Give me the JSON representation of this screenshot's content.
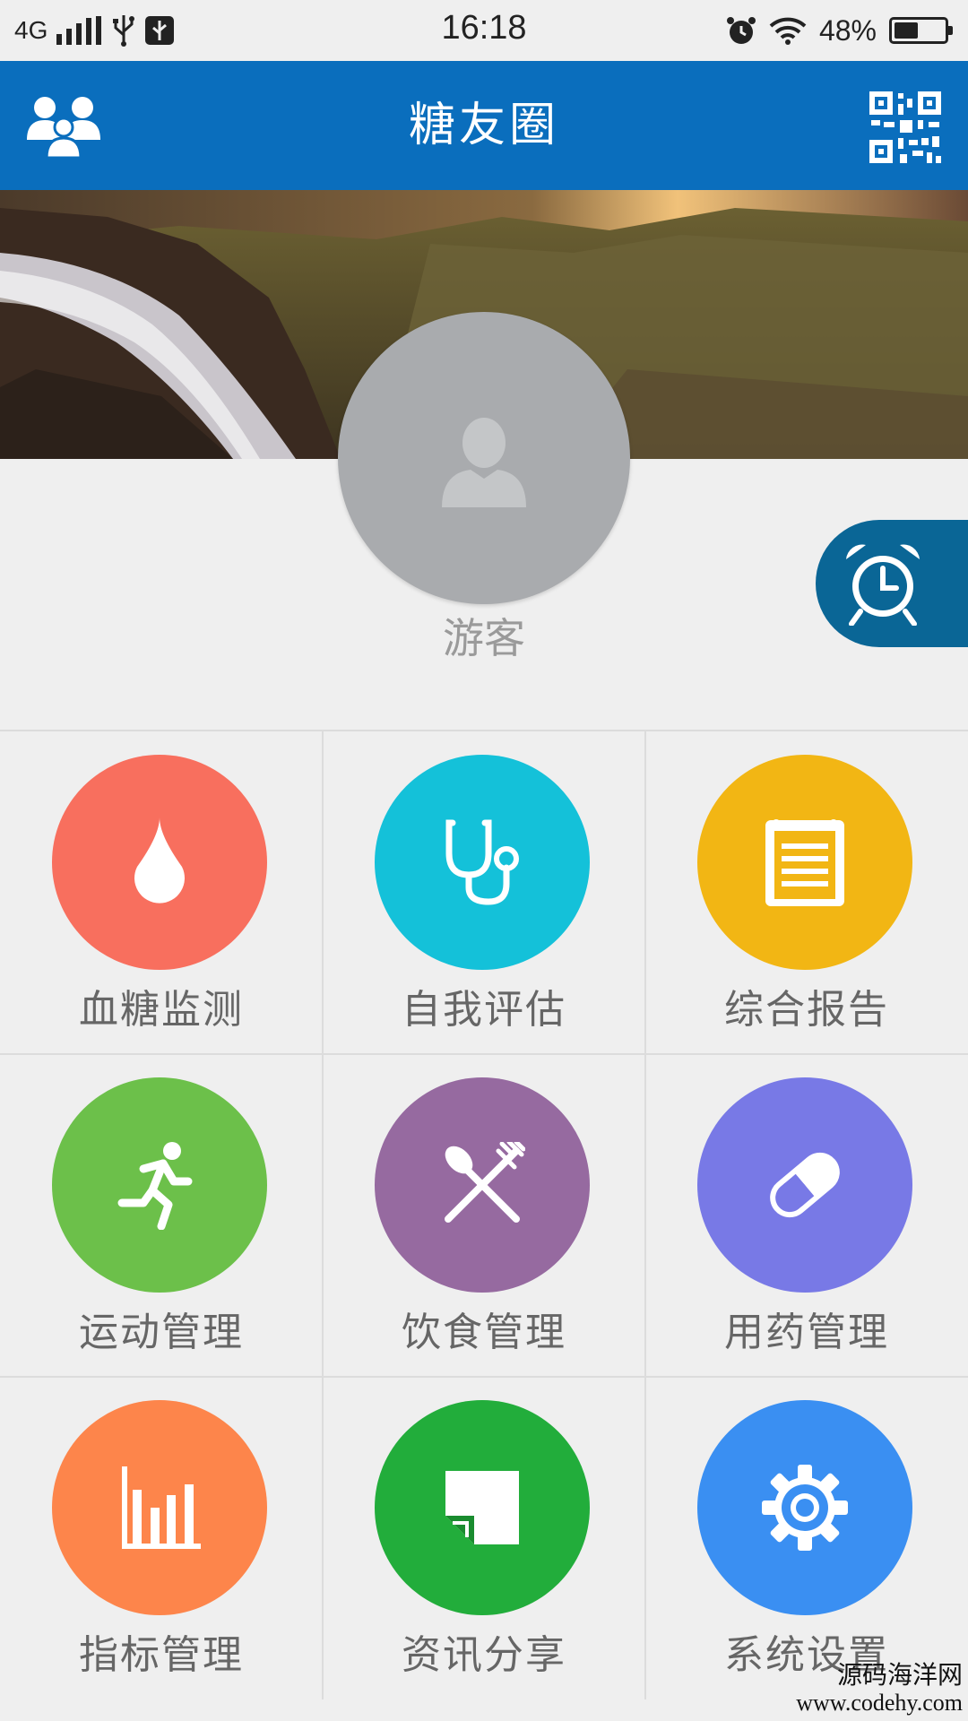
{
  "status_bar": {
    "network": "4G",
    "time": "16:18",
    "battery": "48%",
    "battery_level": 0.48
  },
  "app_bar": {
    "title": "糖友圈",
    "left_icon": "group-icon",
    "right_icon": "qr-code-icon",
    "color": "#0a6ebd"
  },
  "profile": {
    "name": "游客",
    "avatar_icon": "user-silhouette-icon",
    "alarm_icon": "alarm-clock-icon"
  },
  "menu": [
    {
      "label": "血糖监测",
      "icon": "drop-icon",
      "color": "#f86f5e"
    },
    {
      "label": "自我评估",
      "icon": "stethoscope-icon",
      "color": "#14c1d9"
    },
    {
      "label": "综合报告",
      "icon": "notepad-icon",
      "color": "#f2b614"
    },
    {
      "label": "运动管理",
      "icon": "running-icon",
      "color": "#6cc04a"
    },
    {
      "label": "饮食管理",
      "icon": "spoon-fork-icon",
      "color": "#966aa0"
    },
    {
      "label": "用药管理",
      "icon": "pill-icon",
      "color": "#7879e6"
    },
    {
      "label": "指标管理",
      "icon": "bar-chart-icon",
      "color": "#fd854b"
    },
    {
      "label": "资讯分享",
      "icon": "note-icon",
      "color": "#22ad3b"
    },
    {
      "label": "系统设置",
      "icon": "gear-icon",
      "color": "#3a8ff2"
    }
  ],
  "watermark": {
    "line1": "源码海洋网",
    "line2": "www.codehy.com"
  }
}
